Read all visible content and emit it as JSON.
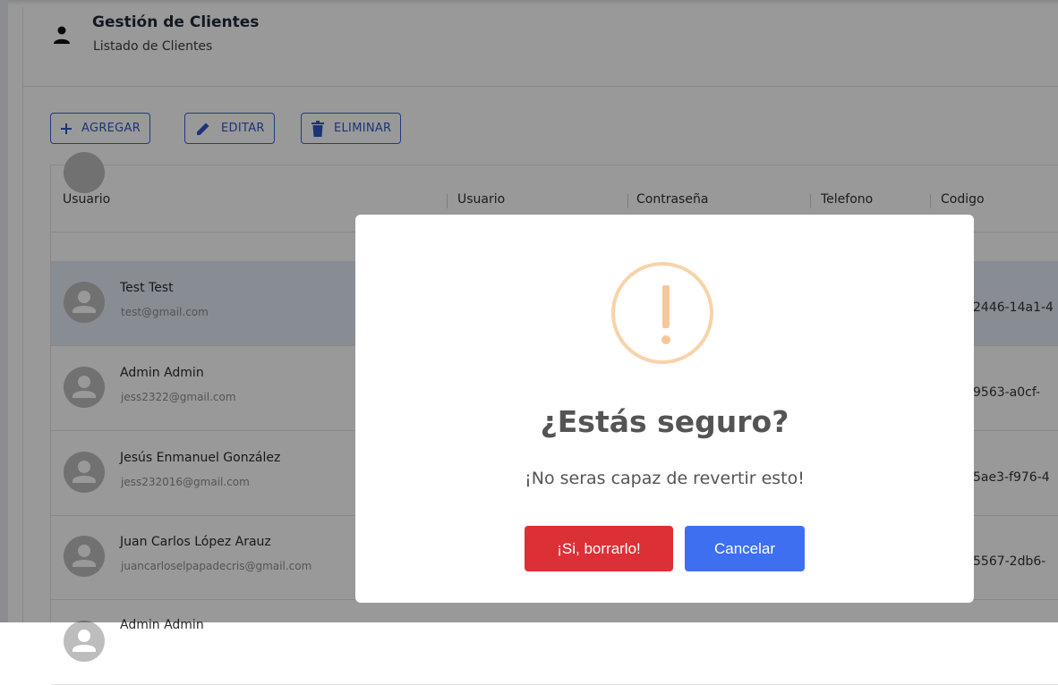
{
  "header": {
    "title": "Gestión de Clientes",
    "subtitle": "Listado de Clientes"
  },
  "toolbar": {
    "add_label": "AGREGAR",
    "edit_label": "EDITAR",
    "delete_label": "ELIMINAR"
  },
  "table": {
    "columns": [
      "Usuario",
      "Usuario",
      "Contraseña",
      "Telefono",
      "Codigo"
    ],
    "rows": [
      {
        "name": "Test Test",
        "email": "test@gmail.com",
        "code": "2446-14a1-4"
      },
      {
        "name": "Admin Admin",
        "email": "jess2322@gmail.com",
        "code": "9563-a0cf-"
      },
      {
        "name": "Jesús Enmanuel González",
        "email": "jess232016@gmail.com",
        "code": "5ae3-f976-4"
      },
      {
        "name": "Juan Carlos López Arauz",
        "email": "juancarloselpapadecris@gmail.com",
        "code": "5567-2db6-"
      },
      {
        "name": "Admin Admin",
        "email": "",
        "code": ""
      }
    ]
  },
  "dialog": {
    "title": "¿Estás seguro?",
    "text": "¡No seras capaz de revertir esto!",
    "confirm_label": "¡Si, borrarlo!",
    "cancel_label": "Cancelar"
  },
  "colors": {
    "accent": "#3b62d6",
    "confirm": "#dc3037",
    "cancel": "#3d6ff0",
    "warning": "#f8bb86"
  },
  "icons": {
    "header": "person-icon",
    "add": "plus-icon",
    "edit": "pencil-icon",
    "delete": "trash-icon",
    "avatar": "person-avatar-icon",
    "dialog": "warning-icon"
  }
}
